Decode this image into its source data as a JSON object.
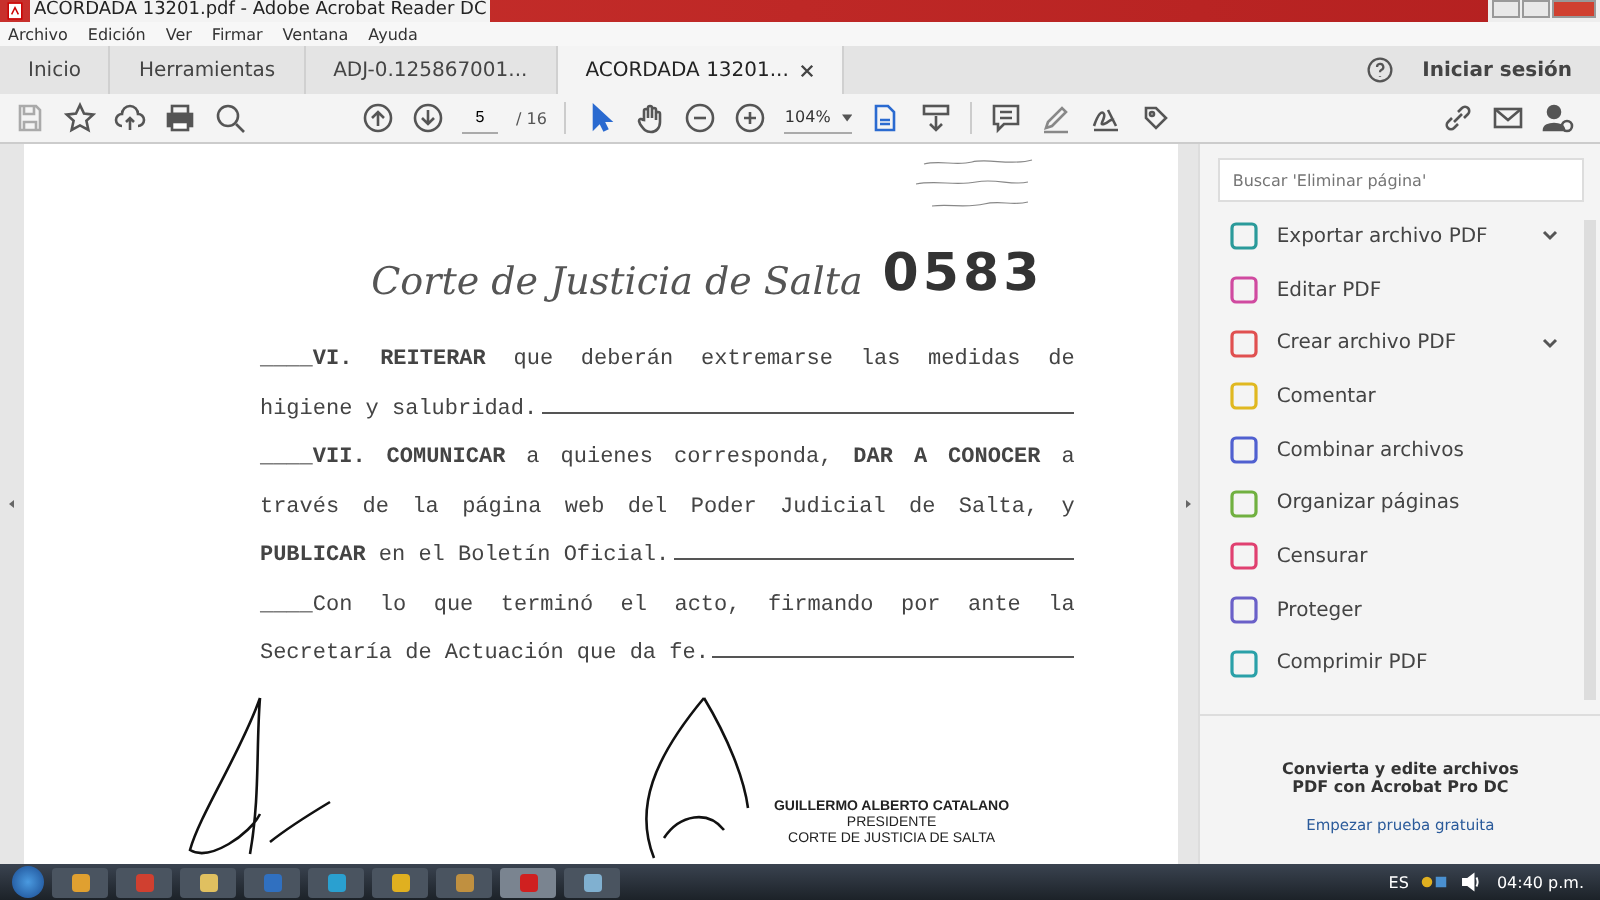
{
  "window": {
    "title": "ACORDADA 13201.pdf - Adobe Acrobat Reader DC"
  },
  "menu": [
    "Archivo",
    "Edición",
    "Ver",
    "Firmar",
    "Ventana",
    "Ayuda"
  ],
  "tabs": [
    {
      "label": "Inicio",
      "selected": false,
      "closable": false
    },
    {
      "label": "Herramientas",
      "selected": false,
      "closable": false
    },
    {
      "label": "ADJ-0.125867001...",
      "selected": false,
      "closable": false
    },
    {
      "label": "ACORDADA 13201...",
      "selected": true,
      "closable": true
    }
  ],
  "sign_in": "Iniciar sesión",
  "toolbar": {
    "page": "5",
    "page_total": "/ 16",
    "zoom": "104%"
  },
  "document": {
    "court_heading": "Corte de Justicia de Salta",
    "number": "0583",
    "lines": [
      {
        "text": "____**VI. REITERAR** que deberán extremarse las medidas de",
        "rule": false
      },
      {
        "text": "higiene y salubridad.",
        "rule": true
      },
      {
        "text": "____**VII. COMUNICAR** a quienes corresponda, **DAR A CONOCER** a",
        "rule": false
      },
      {
        "text": "través de la página web del Poder Judicial de Salta, y",
        "rule": false
      },
      {
        "text": "**PUBLICAR** en el Boletín Oficial.",
        "rule": true
      },
      {
        "text": "____Con lo que terminó el acto, firmando por ante la",
        "rule": false
      },
      {
        "text": "Secretaría de Actuación que da fe.",
        "rule": true
      }
    ],
    "stamp": [
      "GUILLERMO ALBERTO CATALANO",
      "PRESIDENTE",
      "CORTE DE JUSTICIA DE SALTA"
    ]
  },
  "panel": {
    "search": {
      "placeholder": "Buscar 'Eliminar página'"
    },
    "items": [
      {
        "label": "Exportar archivo PDF",
        "color": "#2a9a9a",
        "expandable": true
      },
      {
        "label": "Editar PDF",
        "color": "#d04aa0",
        "expandable": false
      },
      {
        "label": "Crear archivo PDF",
        "color": "#e05050",
        "expandable": true
      },
      {
        "label": "Comentar",
        "color": "#e0b820",
        "expandable": false
      },
      {
        "label": "Combinar archivos",
        "color": "#5060d0",
        "expandable": false
      },
      {
        "label": "Organizar páginas",
        "color": "#70b040",
        "expandable": false
      },
      {
        "label": "Censurar",
        "color": "#e04070",
        "expandable": false
      },
      {
        "label": "Proteger",
        "color": "#6a60c8",
        "expandable": false
      },
      {
        "label": "Comprimir PDF",
        "color": "#2aa0a8",
        "expandable": false
      }
    ],
    "promo": "Convierta y edite archivos PDF con Acrobat Pro DC",
    "trial_link": "Empezar prueba gratuita"
  },
  "taskbar": {
    "language": "ES",
    "clock": "04:40 p.m."
  }
}
